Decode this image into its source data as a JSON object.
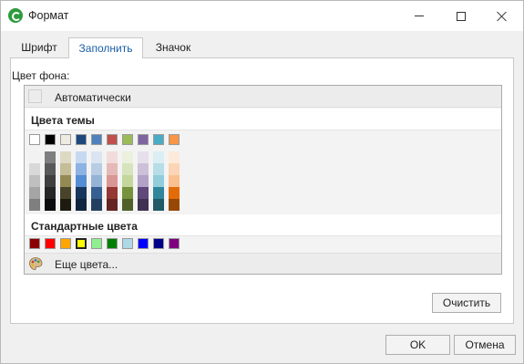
{
  "window": {
    "title": "Формат"
  },
  "tabs": [
    {
      "label": "Шрифт"
    },
    {
      "label": "Заполнить",
      "active": true
    },
    {
      "label": "Значок"
    }
  ],
  "fill": {
    "background_label": "Цвет фона:",
    "auto_label": "Автоматически",
    "theme_colors_heading": "Цвета темы",
    "theme_base": [
      "#ffffff",
      "#000000",
      "#eeece1",
      "#1f497d",
      "#4f81bd",
      "#c0504d",
      "#9bbb59",
      "#8064a2",
      "#4bacc6",
      "#f79646"
    ],
    "theme_shades": [
      [
        "#f2f2f2",
        "#d8d8d8",
        "#bfbfbf",
        "#a5a5a5",
        "#7f7f7f"
      ],
      [
        "#7f7f7f",
        "#595959",
        "#3f3f3f",
        "#262626",
        "#0c0c0c"
      ],
      [
        "#ddd9c3",
        "#c4bd97",
        "#938953",
        "#494429",
        "#1d1b10"
      ],
      [
        "#c6d9f0",
        "#8db3e2",
        "#548dd4",
        "#17365d",
        "#0f243e"
      ],
      [
        "#dbe5f1",
        "#b8cce4",
        "#95b3d7",
        "#366092",
        "#244061"
      ],
      [
        "#f2dcdb",
        "#e5b9b7",
        "#d99694",
        "#953734",
        "#632423"
      ],
      [
        "#ebf1dd",
        "#d7e3bc",
        "#c3d69b",
        "#76923c",
        "#4f6128"
      ],
      [
        "#e5e0ec",
        "#ccc1d9",
        "#b2a2c7",
        "#5f497a",
        "#3f3151"
      ],
      [
        "#dbeef3",
        "#b7dde8",
        "#92cddc",
        "#31859b",
        "#205867"
      ],
      [
        "#fdeada",
        "#fbd5b5",
        "#fac08f",
        "#e36c09",
        "#974806"
      ]
    ],
    "standard_colors_heading": "Стандартные цвета",
    "standard_colors": [
      "#8b0000",
      "#ff0000",
      "#ffa500",
      "#ffff00",
      "#90ee90",
      "#008000",
      "#add8e6",
      "#0000ff",
      "#00008b",
      "#800080"
    ],
    "selected_standard_index": 3,
    "more_colors_label": "Еще цвета...",
    "more_colors_icon": "palette-icon",
    "clear_label": "Очистить"
  },
  "footer": {
    "ok_label": "OK",
    "cancel_label": "Отмена"
  }
}
